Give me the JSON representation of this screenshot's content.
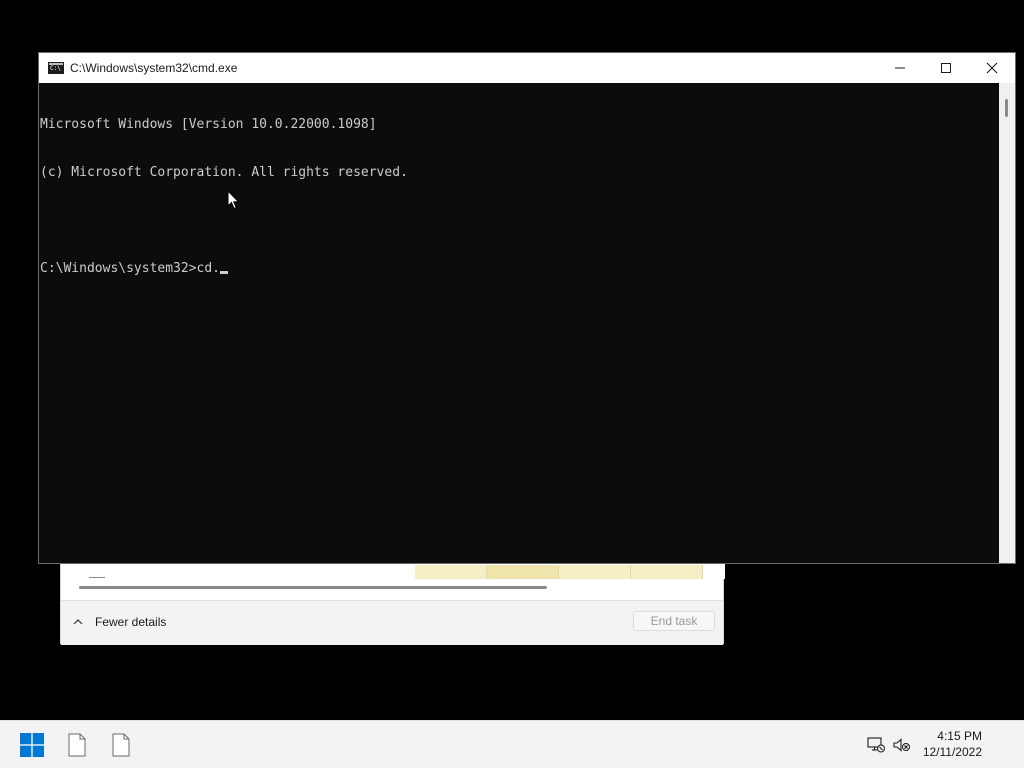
{
  "task_manager": {
    "fewer_details_label": "Fewer details",
    "end_task_label": "End task"
  },
  "cmd_window": {
    "title": "C:\\Windows\\system32\\cmd.exe",
    "app_icon_text": "C:\\",
    "console_lines": [
      "Microsoft Windows [Version 10.0.22000.1098]",
      "(c) Microsoft Corporation. All rights reserved.",
      "",
      "C:\\Windows\\system32>cd."
    ],
    "controls": [
      "minimize-icon",
      "maximize-icon",
      "close-icon"
    ]
  },
  "taskbar": {
    "start_icon": "windows-logo-icon",
    "pinned": [
      "file-icon",
      "file-icon"
    ],
    "tray": [
      "network-no-internet-icon",
      "volume-muted-icon"
    ],
    "clock": {
      "time": "4:15 PM",
      "date": "12/11/2022"
    }
  },
  "colors": {
    "console_bg": "#0c0c0c",
    "console_fg": "#cccccc",
    "windows_blue": "#0078d4",
    "taskbar_bg": "#f3f3f3"
  }
}
